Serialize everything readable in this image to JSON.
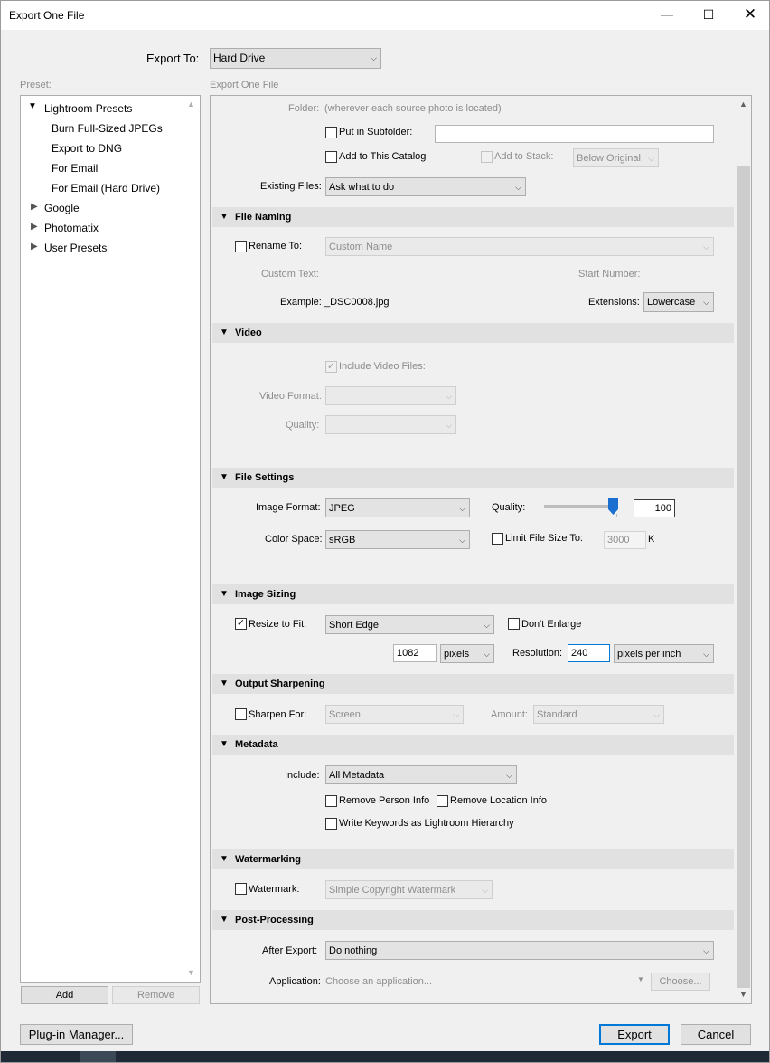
{
  "window": {
    "title": "Export One File"
  },
  "export_to": {
    "label": "Export To:",
    "value": "Hard Drive"
  },
  "preset": {
    "label": "Preset:",
    "groups": [
      {
        "name": "Lightroom Presets",
        "items": [
          "Burn Full-Sized JPEGs",
          "Export to DNG",
          "For Email",
          "For Email (Hard Drive)"
        ]
      },
      {
        "name": "Google"
      },
      {
        "name": "Photomatix"
      },
      {
        "name": "User Presets"
      }
    ],
    "add": "Add",
    "remove": "Remove"
  },
  "panel_title": "Export One File",
  "location": {
    "folder_label": "Folder:",
    "folder_value": "(wherever each source photo is located)",
    "subfolder_label": "Put in Subfolder:",
    "add_catalog": "Add to This Catalog",
    "add_stack": "Add to Stack:",
    "stack_option": "Below Original",
    "existing_label": "Existing Files:",
    "existing_value": "Ask what to do"
  },
  "file_naming": {
    "title": "File Naming",
    "rename_label": "Rename To:",
    "rename_value": "Custom Name",
    "custom_text": "Custom Text:",
    "start_number": "Start Number:",
    "example_label": "Example:",
    "example_value": "_DSC0008.jpg",
    "extensions_label": "Extensions:",
    "extensions_value": "Lowercase"
  },
  "video": {
    "title": "Video",
    "include": "Include Video Files:",
    "format": "Video Format:",
    "quality": "Quality:"
  },
  "file_settings": {
    "title": "File Settings",
    "format_label": "Image Format:",
    "format_value": "JPEG",
    "quality_label": "Quality:",
    "quality_value": "100",
    "quality_fraction": 1.0,
    "colorspace_label": "Color Space:",
    "colorspace_value": "sRGB",
    "limit_label": "Limit File Size To:",
    "limit_value": "3000",
    "limit_unit": "K"
  },
  "image_sizing": {
    "title": "Image Sizing",
    "resize_label": "Resize to Fit:",
    "resize_value": "Short Edge",
    "dont_enlarge": "Don't Enlarge",
    "size_value": "1082",
    "unit": "pixels",
    "resolution_label": "Resolution:",
    "resolution_value": "240",
    "resolution_unit": "pixels per inch"
  },
  "output_sharpening": {
    "title": "Output Sharpening",
    "sharpen_label": "Sharpen For:",
    "sharpen_value": "Screen",
    "amount_label": "Amount:",
    "amount_value": "Standard"
  },
  "metadata": {
    "title": "Metadata",
    "include_label": "Include:",
    "include_value": "All Metadata",
    "remove_person": "Remove Person Info",
    "remove_location": "Remove Location Info",
    "keywords": "Write Keywords as Lightroom Hierarchy"
  },
  "watermarking": {
    "title": "Watermarking",
    "label": "Watermark:",
    "value": "Simple Copyright Watermark"
  },
  "post_processing": {
    "title": "Post-Processing",
    "after_label": "After Export:",
    "after_value": "Do nothing",
    "app_label": "Application:",
    "app_placeholder": "Choose an application...",
    "choose": "Choose..."
  },
  "footer": {
    "plugin_manager": "Plug-in Manager...",
    "export": "Export",
    "cancel": "Cancel"
  },
  "colors": {
    "accent": "#0078d7",
    "slider": "#1a6fd1",
    "section_bg": "#e1e1e1"
  }
}
